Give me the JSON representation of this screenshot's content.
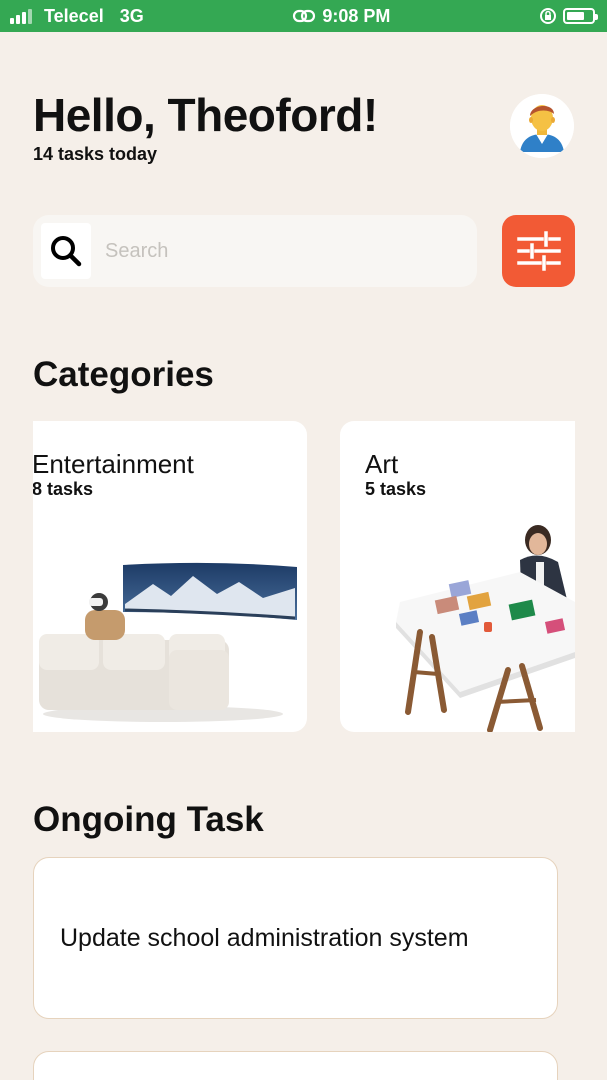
{
  "status_bar": {
    "carrier": "Telecel",
    "network": "3G",
    "time": "9:08 PM"
  },
  "header": {
    "greeting": "Hello, Theoford!",
    "subtitle": "14 tasks today"
  },
  "search": {
    "placeholder": "Search",
    "value": ""
  },
  "categories": {
    "title": "Categories",
    "items": [
      {
        "name": "Entertainment",
        "count": "8 tasks"
      },
      {
        "name": "Art",
        "count": "5 tasks"
      }
    ]
  },
  "ongoing": {
    "title": "Ongoing Task",
    "tasks": [
      {
        "label": "Update school administration system"
      },
      {
        "label": ""
      }
    ]
  },
  "colors": {
    "background": "#f5efe9",
    "status_bar": "#34a853",
    "accent": "#f25a35",
    "card_border": "#e6d3bd"
  },
  "icons": {
    "signal": "signal-bars-icon",
    "link": "link-icon",
    "lock_rotation": "rotation-lock-icon",
    "battery": "battery-icon",
    "avatar": "user-avatar-icon",
    "search": "search-icon",
    "filter": "sliders-icon"
  }
}
